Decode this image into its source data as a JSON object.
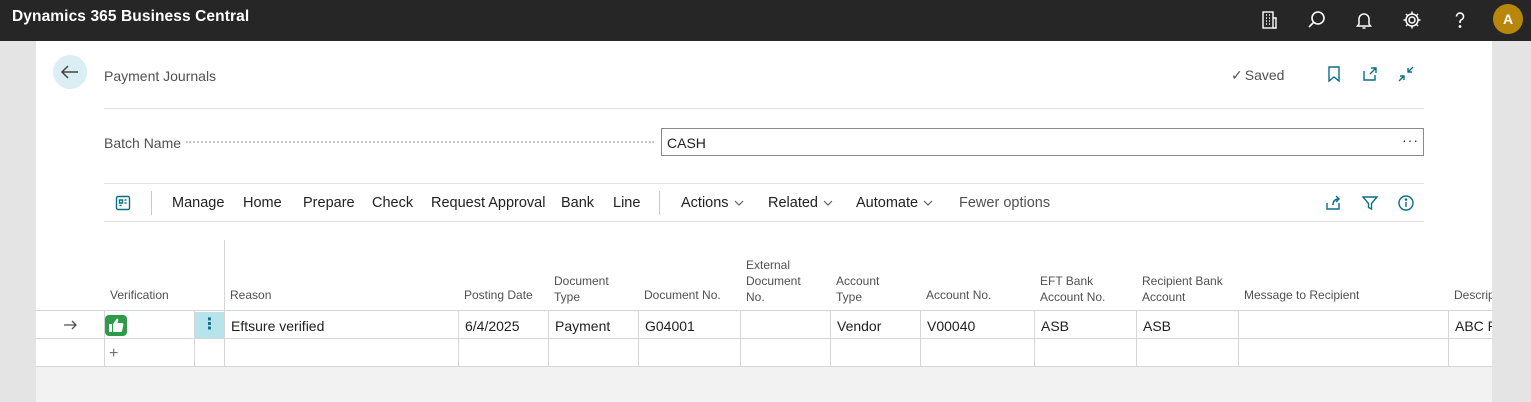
{
  "app": {
    "title": "Dynamics 365 Business Central",
    "user_initial": "A",
    "icons": [
      "building-icon",
      "search-icon",
      "bell-icon",
      "gear-icon",
      "help-icon"
    ],
    "avatar_color": "#b8860b"
  },
  "page": {
    "title": "Payment Journals",
    "saved_label": "Saved",
    "accent_color": "#0a6e85"
  },
  "batch": {
    "label": "Batch Name",
    "value": "CASH",
    "more": "···"
  },
  "actions": {
    "items": [
      "Manage",
      "Home",
      "Prepare",
      "Check",
      "Request Approval",
      "Bank",
      "Line"
    ],
    "dropdowns": [
      "Actions",
      "Related",
      "Automate"
    ],
    "fewer_options": "Fewer options"
  },
  "grid": {
    "columns": {
      "verification": "Verification",
      "reason": "Reason",
      "posting_date": "Posting Date",
      "document_type": [
        "Document",
        "Type"
      ],
      "document_no": "Document No.",
      "external_document_no": [
        "External",
        "Document",
        "No."
      ],
      "account_type": [
        "Account",
        "Type"
      ],
      "account_no": "Account No.",
      "eft_bank_account_no": [
        "EFT Bank",
        "Account No."
      ],
      "recipient_bank_account": [
        "Recipient Bank",
        "Account"
      ],
      "message_to_recipient": "Message to Recipient",
      "description": "Descrip"
    },
    "rows": [
      {
        "verification_icon": "thumbs-up-icon",
        "reason": "Eftsure verified",
        "posting_date": "6/4/2025",
        "document_type": "Payment",
        "document_no": "G04001",
        "external_document_no": "",
        "account_type": "Vendor",
        "account_no": "V00040",
        "eft_bank_account_no": "ASB",
        "recipient_bank_account": "ASB",
        "message_to_recipient": "",
        "description": "ABC P"
      }
    ],
    "verified_color": "#2e9b4b"
  }
}
